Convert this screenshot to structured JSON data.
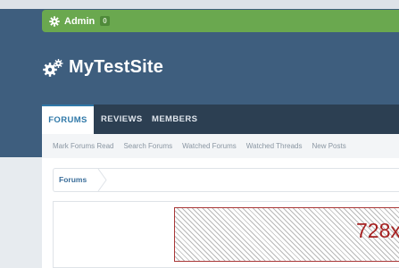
{
  "admin_bar": {
    "label": "Admin",
    "badge": "0"
  },
  "site": {
    "name": "MyTestSite"
  },
  "nav": {
    "tabs": [
      {
        "label": "FORUMS",
        "active": true
      },
      {
        "label": "REVIEWS",
        "active": false
      },
      {
        "label": "MEMBERS",
        "active": false
      }
    ]
  },
  "subnav": {
    "links": [
      "Mark Forums Read",
      "Search Forums",
      "Watched Forums",
      "Watched Threads",
      "New Posts"
    ]
  },
  "breadcrumb": {
    "item": "Forums"
  },
  "ad": {
    "label": "728x"
  },
  "colors": {
    "header_bg": "#3e5e7e",
    "admin_green": "#6aa84f",
    "nav_dark": "#2c3f52",
    "accent_blue": "#2f78a8",
    "ad_red": "#a52020"
  }
}
